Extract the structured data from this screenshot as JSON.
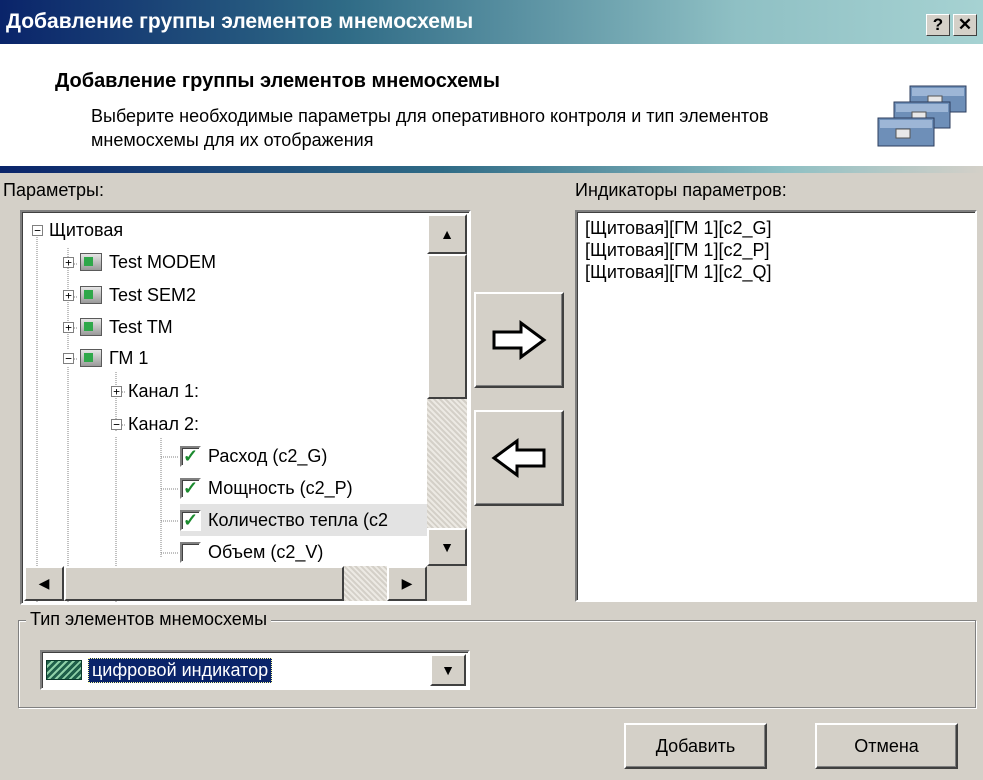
{
  "window": {
    "title": "Добавление группы элементов мнемосхемы",
    "help_button": "?",
    "close_button": "✕"
  },
  "header": {
    "title": "Добавление группы элементов мнемосхемы",
    "description": "Выберите необходимые параметры для оперативного контроля и тип элементов мнемосхемы для их отображения"
  },
  "params": {
    "label": "Параметры:",
    "tree": {
      "root": "Щитовая",
      "device1": "Test MODEM",
      "device2": "Test SEM2",
      "device3": "Test TM",
      "device4": "ГМ 1",
      "channel1": "Канал 1:",
      "channel2": "Канал 2:",
      "param1": "Расход  (c2_G)",
      "param2": "Мощность  (c2_P)",
      "param3": "Количество тепла  (c2",
      "param4": "Объем  (c2_V)"
    },
    "checked": [
      true,
      true,
      true,
      false
    ]
  },
  "buttons": {
    "add_arrow": "add-right-arrow",
    "remove_arrow": "remove-left-arrow",
    "add": "Добавить",
    "cancel": "Отмена"
  },
  "indicators": {
    "label": "Индикаторы параметров:",
    "items": [
      "[Щитовая][ГМ 1][c2_G]",
      "[Щитовая][ГМ 1][c2_P]",
      "[Щитовая][ГМ 1][c2_Q]"
    ]
  },
  "element_type": {
    "legend": "Тип элементов мнемосхемы",
    "selected": "цифровой индикатор"
  }
}
